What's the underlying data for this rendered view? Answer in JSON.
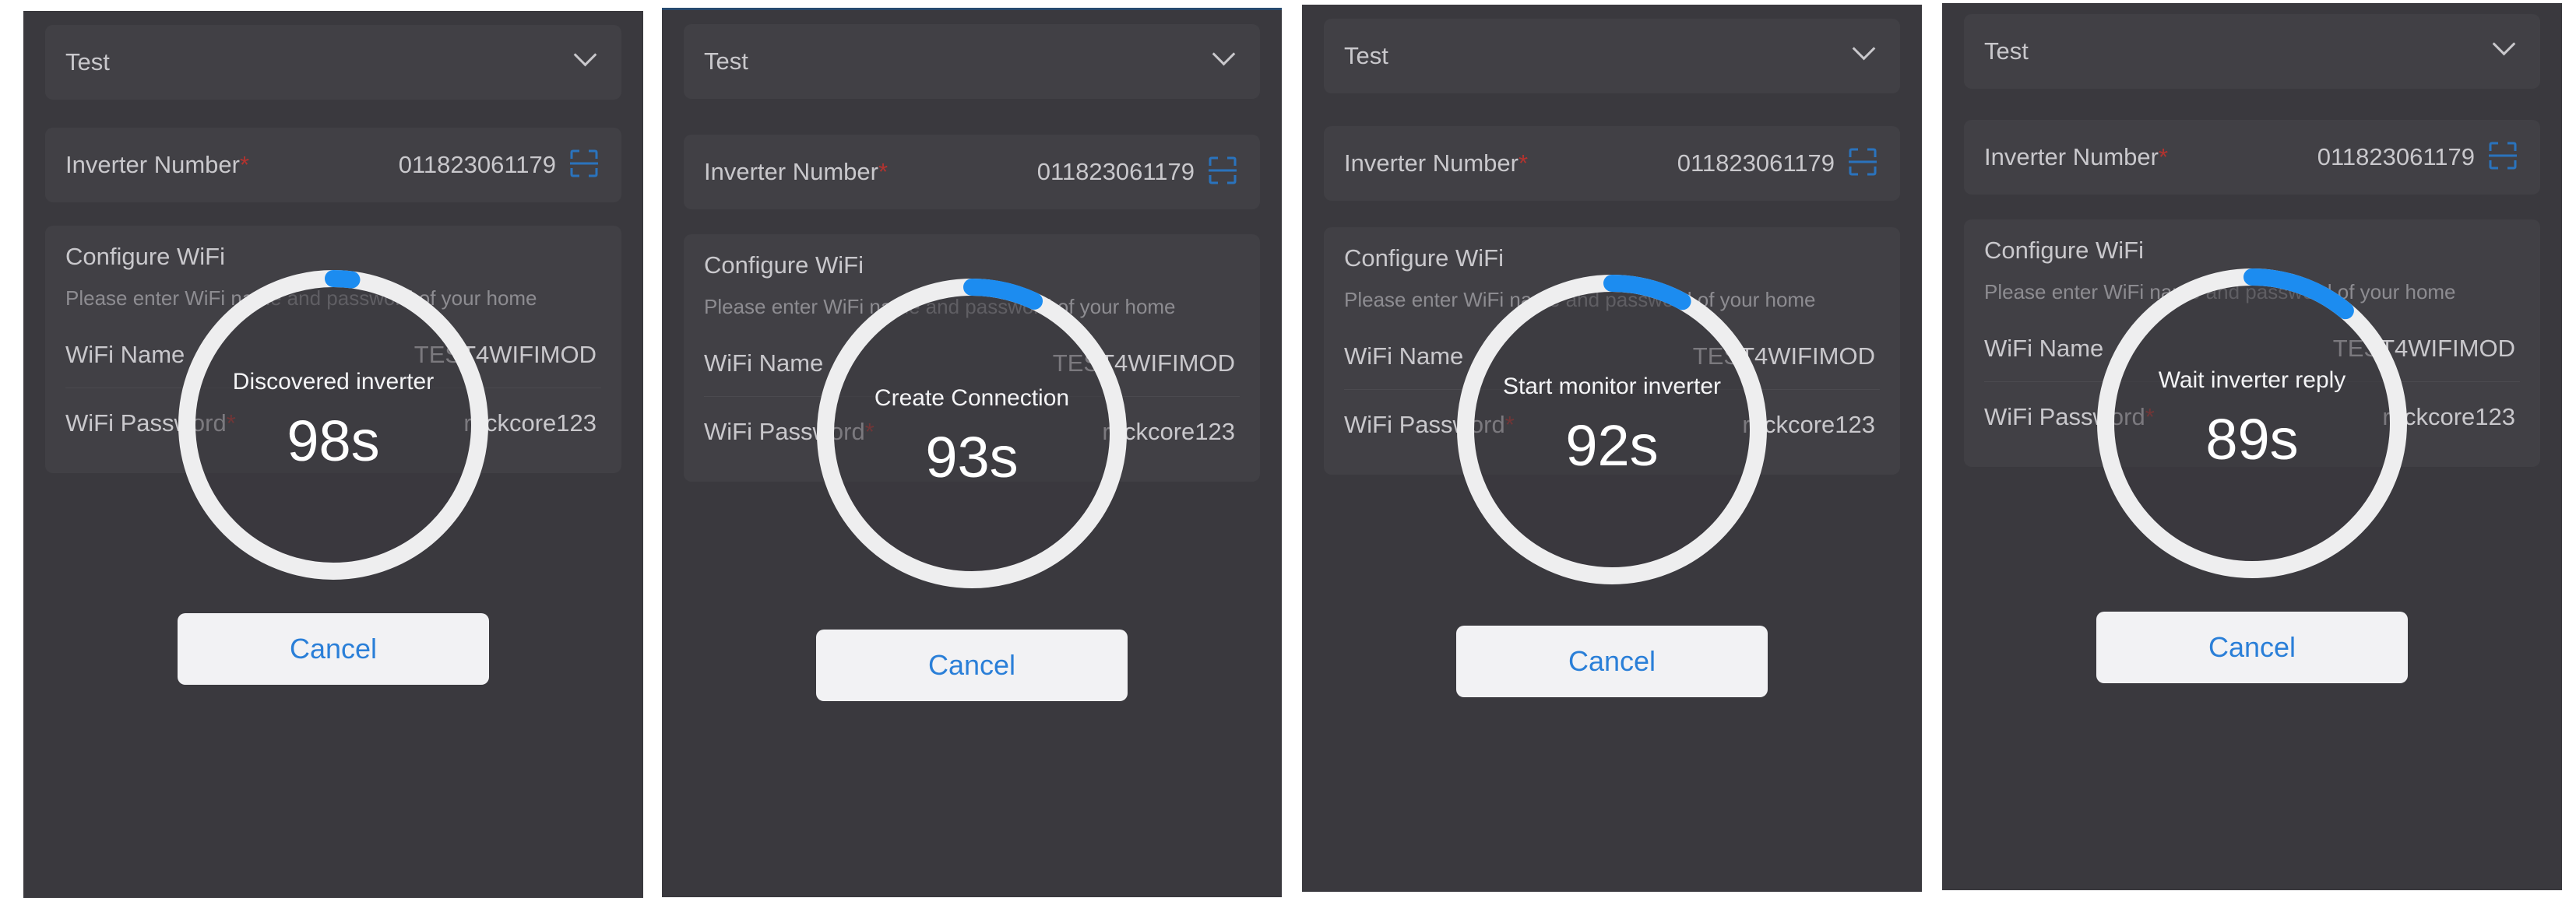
{
  "screens": [
    {
      "select_value": "Test",
      "inverter_label": "Inverter Number",
      "inverter_value": "011823061179",
      "config_title": "Configure WiFi",
      "config_hint": "Please enter WiFi name and password of your home",
      "wifi_name_label": "WiFi Name",
      "wifi_name_value": "TEST4WIFIMOD",
      "wifi_password_label": "WiFi Password",
      "wifi_password_value": "rockcore123",
      "status": "Discovered inverter",
      "countdown": "98s",
      "progress": 0.02,
      "cancel_label": "Cancel"
    },
    {
      "select_value": "Test",
      "inverter_label": "Inverter Number",
      "inverter_value": "011823061179",
      "config_title": "Configure WiFi",
      "config_hint": "Please enter WiFi name and password of your home",
      "wifi_name_label": "WiFi Name",
      "wifi_name_value": "TEST4WIFIMOD",
      "wifi_password_label": "WiFi Password",
      "wifi_password_value": "rockcore123",
      "status": "Create Connection",
      "countdown": "93s",
      "progress": 0.07,
      "cancel_label": "Cancel"
    },
    {
      "select_value": "Test",
      "inverter_label": "Inverter Number",
      "inverter_value": "011823061179",
      "config_title": "Configure WiFi",
      "config_hint": "Please enter WiFi name and password of your home",
      "wifi_name_label": "WiFi Name",
      "wifi_name_value": "TEST4WIFIMOD",
      "wifi_password_label": "WiFi Password",
      "wifi_password_value": "rockcore123",
      "status": "Start monitor inverter",
      "countdown": "92s",
      "progress": 0.08,
      "cancel_label": "Cancel"
    },
    {
      "select_value": "Test",
      "inverter_label": "Inverter Number",
      "inverter_value": "011823061179",
      "config_title": "Configure WiFi",
      "config_hint": "Please enter WiFi name and password of your home",
      "wifi_name_label": "WiFi Name",
      "wifi_name_value": "TEST4WIFIMOD",
      "wifi_password_label": "WiFi Password",
      "wifi_password_value": "rockcore123",
      "status": "Wait inverter reply",
      "countdown": "89s",
      "progress": 0.11,
      "cancel_label": "Cancel"
    }
  ],
  "colors": {
    "overlay_background": "#3a393e",
    "ring_track": "#eeeeef",
    "ring_progress": "#1c8cf0",
    "accent_link": "#2a7fd8",
    "required_mark": "#b2332f"
  },
  "icons": {
    "dropdown": "chevron-down-icon",
    "scanner": "scan-icon"
  }
}
